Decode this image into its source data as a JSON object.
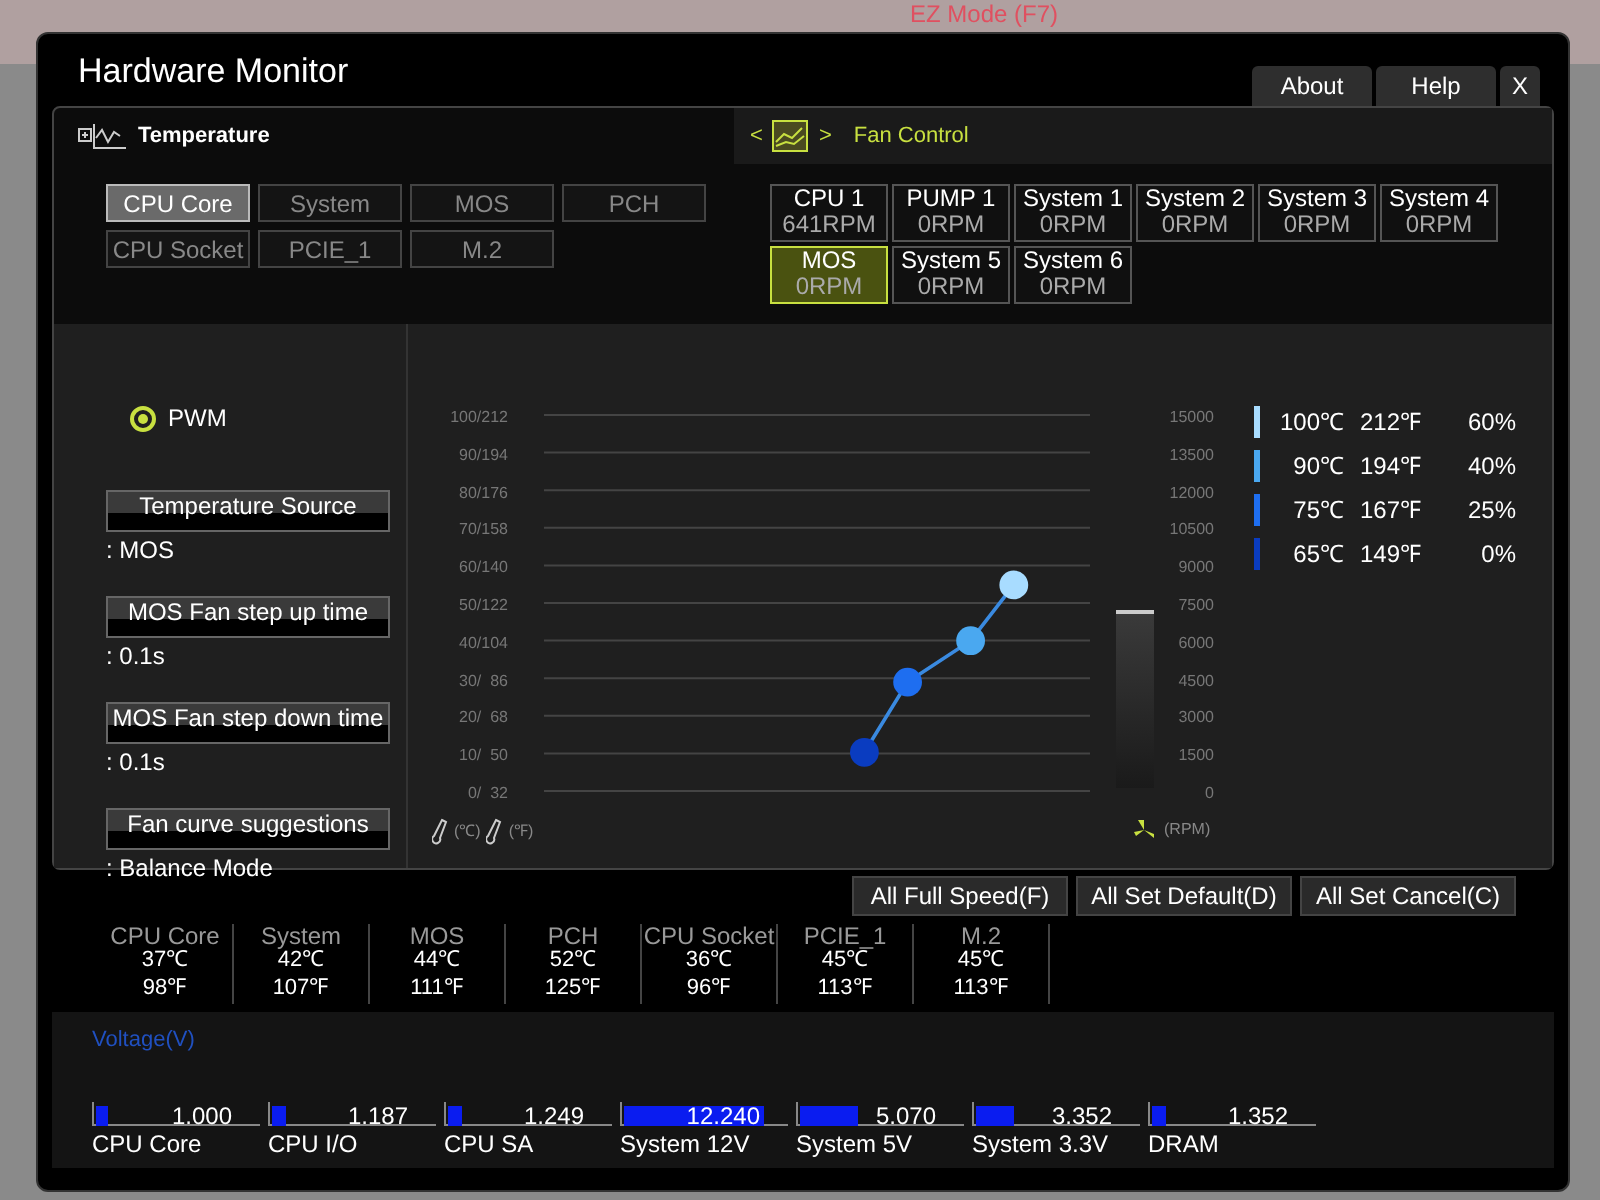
{
  "background": {
    "mode_label": "EZ Mode (F7)"
  },
  "window": {
    "title": "Hardware Monitor",
    "tabs": [
      {
        "label": "About"
      },
      {
        "label": "Help"
      },
      {
        "label": "X"
      }
    ]
  },
  "temperature": {
    "title": "Temperature",
    "sensors": [
      {
        "label": "CPU Core",
        "selected": true
      },
      {
        "label": "System",
        "selected": false
      },
      {
        "label": "MOS",
        "selected": false
      },
      {
        "label": "PCH",
        "selected": false
      },
      {
        "label": "CPU Socket",
        "selected": false
      },
      {
        "label": "PCIE_1",
        "selected": false
      },
      {
        "label": "M.2",
        "selected": false
      }
    ]
  },
  "fan_control": {
    "title": "Fan Control",
    "prev": "<",
    "next": ">",
    "fans": [
      {
        "name": "CPU 1",
        "rpm": "641RPM",
        "selected": false
      },
      {
        "name": "PUMP 1",
        "rpm": "0RPM",
        "selected": false
      },
      {
        "name": "System 1",
        "rpm": "0RPM",
        "selected": false
      },
      {
        "name": "System 2",
        "rpm": "0RPM",
        "selected": false
      },
      {
        "name": "System 3",
        "rpm": "0RPM",
        "selected": false
      },
      {
        "name": "System 4",
        "rpm": "0RPM",
        "selected": false
      },
      {
        "name": "MOS",
        "rpm": "0RPM",
        "selected": true
      },
      {
        "name": "System 5",
        "rpm": "0RPM",
        "selected": false
      },
      {
        "name": "System 6",
        "rpm": "0RPM",
        "selected": false
      }
    ]
  },
  "mode": {
    "label": "PWM",
    "selected": true
  },
  "settings": [
    {
      "button": "Temperature Source",
      "value": ": MOS"
    },
    {
      "button": "MOS Fan step up time",
      "value": ": 0.1s"
    },
    {
      "button": "MOS Fan step down time",
      "value": ": 0.1s"
    },
    {
      "button": "Fan curve suggestions",
      "value": ": Balance Mode"
    }
  ],
  "curve": {
    "temp_ticks": [
      "100/212",
      "90/194",
      "80/176",
      "70/158",
      "60/140",
      "50/122",
      "40/104",
      "30/  86",
      "20/  68",
      "10/  50",
      "0/  32"
    ],
    "rpm_ticks": [
      "15000",
      "13500",
      "12000",
      "10500",
      "9000",
      "7500",
      "6000",
      "4500",
      "3000",
      "1500",
      "0"
    ],
    "celsius_unit": "(℃)",
    "fahrenheit_unit": "(℉)",
    "rpm_unit": "(RPM)"
  },
  "legend": [
    {
      "celsius": "100℃",
      "fahrenheit": "212℉",
      "percent": "60%",
      "color": "#a8dcff"
    },
    {
      "celsius": "90℃",
      "fahrenheit": "194℉",
      "percent": "40%",
      "color": "#4aa8f0"
    },
    {
      "celsius": "75℃",
      "fahrenheit": "167℉",
      "percent": "25%",
      "color": "#1e6ef0"
    },
    {
      "celsius": "65℃",
      "fahrenheit": "149℉",
      "percent": "0%",
      "color": "#0a3cc0"
    }
  ],
  "actions": [
    "All Full Speed(F)",
    "All Set Default(D)",
    "All Set Cancel(C)"
  ],
  "readings": [
    {
      "name": "CPU Core",
      "celsius": "37℃",
      "fahrenheit": "98℉"
    },
    {
      "name": "System",
      "celsius": "42℃",
      "fahrenheit": "107℉"
    },
    {
      "name": "MOS",
      "celsius": "44℃",
      "fahrenheit": "111℉"
    },
    {
      "name": "PCH",
      "celsius": "52℃",
      "fahrenheit": "125℉"
    },
    {
      "name": "CPU Socket",
      "celsius": "36℃",
      "fahrenheit": "96℉"
    },
    {
      "name": "PCIE_1",
      "celsius": "45℃",
      "fahrenheit": "113℉"
    },
    {
      "name": "M.2",
      "celsius": "45℃",
      "fahrenheit": "113℉"
    }
  ],
  "voltage": {
    "title": "Voltage(V)",
    "rails": [
      {
        "name": "CPU Core",
        "value": "1.000",
        "level": 0.07
      },
      {
        "name": "CPU I/O",
        "value": "1.187",
        "level": 0.08
      },
      {
        "name": "CPU SA",
        "value": "1.249",
        "level": 0.08
      },
      {
        "name": "System 12V",
        "value": "12.240",
        "level": 0.85
      },
      {
        "name": "System 5V",
        "value": "5.070",
        "level": 0.35
      },
      {
        "name": "System 3.3V",
        "value": "3.352",
        "level": 0.23
      },
      {
        "name": "DRAM",
        "value": "1.352",
        "level": 0.09
      }
    ]
  }
}
